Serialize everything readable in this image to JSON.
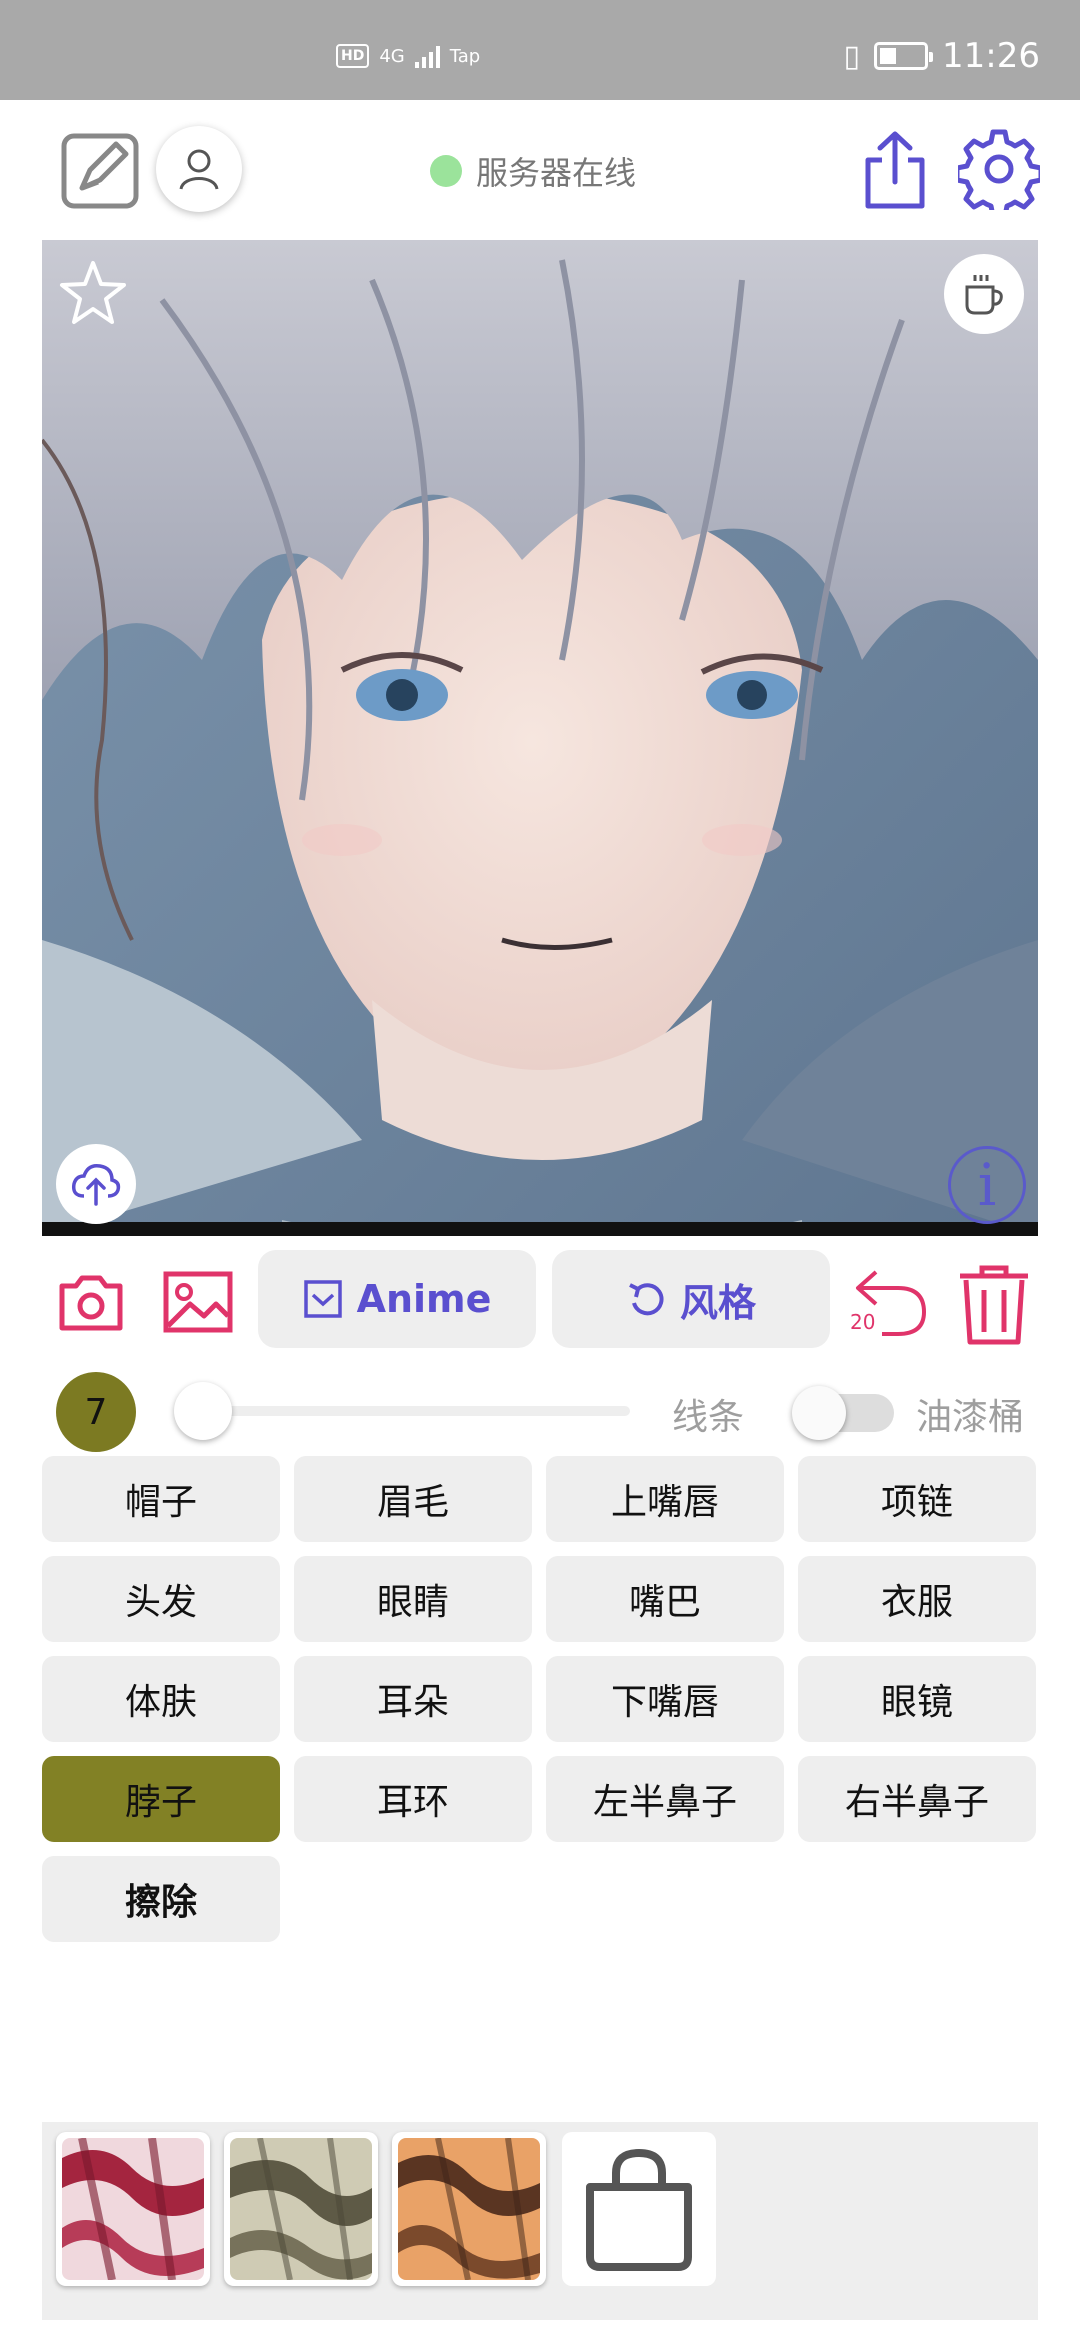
{
  "status_bar": {
    "hd": "HD",
    "network": "4G",
    "carrier": "Tap",
    "time": "11:26"
  },
  "header": {
    "server_status": "服务器在线",
    "server_status_color": "#9be39b"
  },
  "canvas": {
    "image_subject": "anime-portrait-silver-hair",
    "favorite_icon": "star-icon",
    "coffee_icon": "coffee-icon",
    "upload_icon": "cloud-upload-icon",
    "info_label": "i"
  },
  "toolbar": {
    "anime_label": "Anime",
    "style_label": "风格",
    "undo_count": "20",
    "accent_color": "#e0346a",
    "primary_color": "#5a4fcf"
  },
  "brush": {
    "size": "7",
    "slider_value": 0.0,
    "lines_label": "线条",
    "bucket_label": "油漆桶",
    "bucket_enabled": false
  },
  "parts": [
    "帽子",
    "眉毛",
    "上嘴唇",
    "项链",
    "头发",
    "眼睛",
    "嘴巴",
    "衣服",
    "体肤",
    "耳朵",
    "下嘴唇",
    "眼镜",
    "脖子",
    "耳环",
    "左半鼻子",
    "右半鼻子",
    "擦除"
  ],
  "selected_part": "脖子",
  "palette": {
    "swatches": [
      "crimson-texture",
      "olive-texture",
      "orange-texture"
    ],
    "shop_icon": "shopping-bag-icon"
  }
}
